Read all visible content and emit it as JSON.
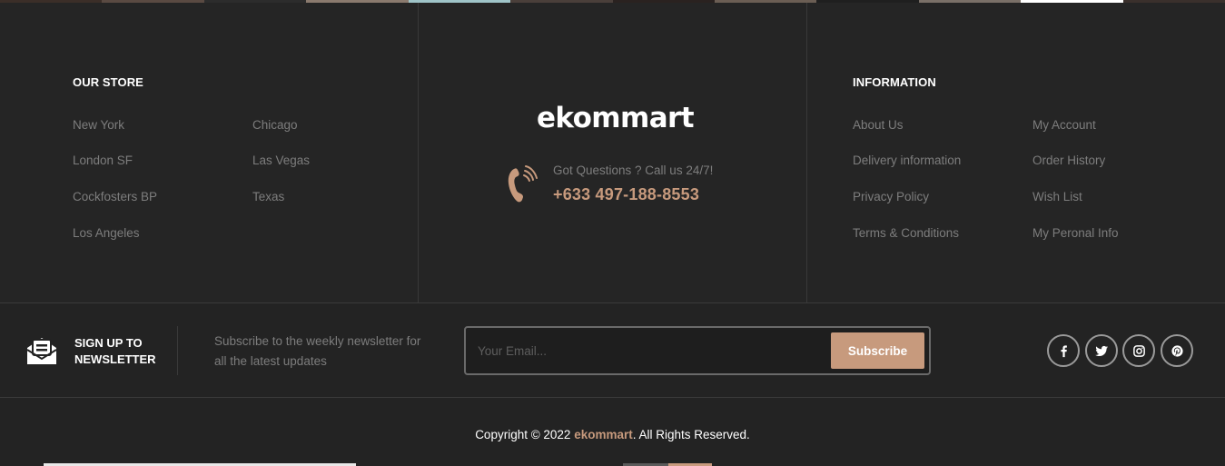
{
  "photo_strip": {
    "colors": [
      "#3b2e28",
      "#5a4a42",
      "#2c2c2c",
      "#8a7a6e",
      "#9fc4c8",
      "#4a3f3a",
      "#2a2220",
      "#6b5e54",
      "#1f1f1f",
      "#7a7068",
      "#ffffff",
      "#3a302c"
    ]
  },
  "our_store": {
    "heading": "OUR STORE",
    "col1": [
      "New York",
      "London SF",
      "Cockfosters BP",
      "Los Angeles"
    ],
    "col2": [
      "Chicago",
      "Las Vegas",
      "Texas"
    ]
  },
  "center": {
    "logo": "ekommart",
    "question": "Got Questions ? Call us 24/7!",
    "phone": "+633 497-188-8553",
    "icon": "phone-call-icon"
  },
  "information": {
    "heading": "INFORMATION",
    "col1": [
      "About Us",
      "Delivery information",
      "Privacy Policy",
      "Terms & Conditions"
    ],
    "col2": [
      "My Account",
      "Order History",
      "Wish List",
      "My Peronal Info"
    ]
  },
  "newsletter": {
    "title": "SIGN UP TO NEWSLETTER",
    "description": "Subscribe to the weekly newsletter for all the latest updates",
    "email_placeholder": "Your Email...",
    "subscribe_label": "Subscribe",
    "icon": "mail-open-icon"
  },
  "social": [
    {
      "name": "facebook",
      "icon": "facebook-icon"
    },
    {
      "name": "twitter",
      "icon": "twitter-icon"
    },
    {
      "name": "instagram",
      "icon": "instagram-icon"
    },
    {
      "name": "pinterest",
      "icon": "pinterest-icon"
    }
  ],
  "copyright": {
    "prefix": "Copyright © 2022 ",
    "brand": "ekommart",
    "suffix": ". All Rights Reserved."
  },
  "colors": {
    "background": "#252525",
    "accent": "#c79a7d",
    "muted_text": "#7d7d7d",
    "heading_text": "#ffffff",
    "divider": "#3a3a3a"
  }
}
